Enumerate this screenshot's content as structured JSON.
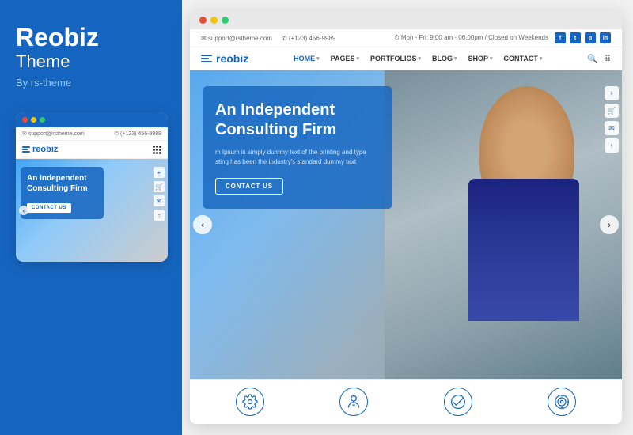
{
  "brand": {
    "title": "Reobiz",
    "subtitle": "Theme",
    "by": "By rs-theme"
  },
  "mobile": {
    "dots": [
      "red",
      "yellow",
      "green"
    ],
    "infobar": {
      "email": "✉ support@rstheme.com",
      "phone": "✆ (+123) 456-9989"
    },
    "logo": "reobiz",
    "hero": {
      "title": "An Independent Consulting Firm",
      "contact_btn": "CONTACT US"
    },
    "sidebar_icons": [
      "+",
      "🛒",
      "✉",
      "↑"
    ]
  },
  "desktop": {
    "infobar": {
      "email": "✉ support@rstheme.com",
      "phone": "✆ (+123) 456-9989",
      "hours": "⏱ Mon - Fri: 9:00 am - 06:00pm / Closed on Weekends"
    },
    "nav": {
      "logo": "reobiz",
      "items": [
        {
          "label": "HOME",
          "has_caret": true
        },
        {
          "label": "PAGES",
          "has_caret": true
        },
        {
          "label": "PORTFOLIOS",
          "has_caret": true
        },
        {
          "label": "BLOG",
          "has_caret": true
        },
        {
          "label": "SHOP",
          "has_caret": true
        },
        {
          "label": "CONTACT",
          "has_caret": true
        }
      ]
    },
    "hero": {
      "title": "An Independent Consulting Firm",
      "description": "m Ipsum is simply dummy text of the printing and type\nsting has been the industry's standard dummy text",
      "contact_btn": "CONTACT US"
    },
    "bottom_icons": [
      {
        "icon": "⚙",
        "label": ""
      },
      {
        "icon": "👤",
        "label": ""
      },
      {
        "icon": "✓",
        "label": ""
      },
      {
        "icon": "🎯",
        "label": ""
      }
    ]
  }
}
